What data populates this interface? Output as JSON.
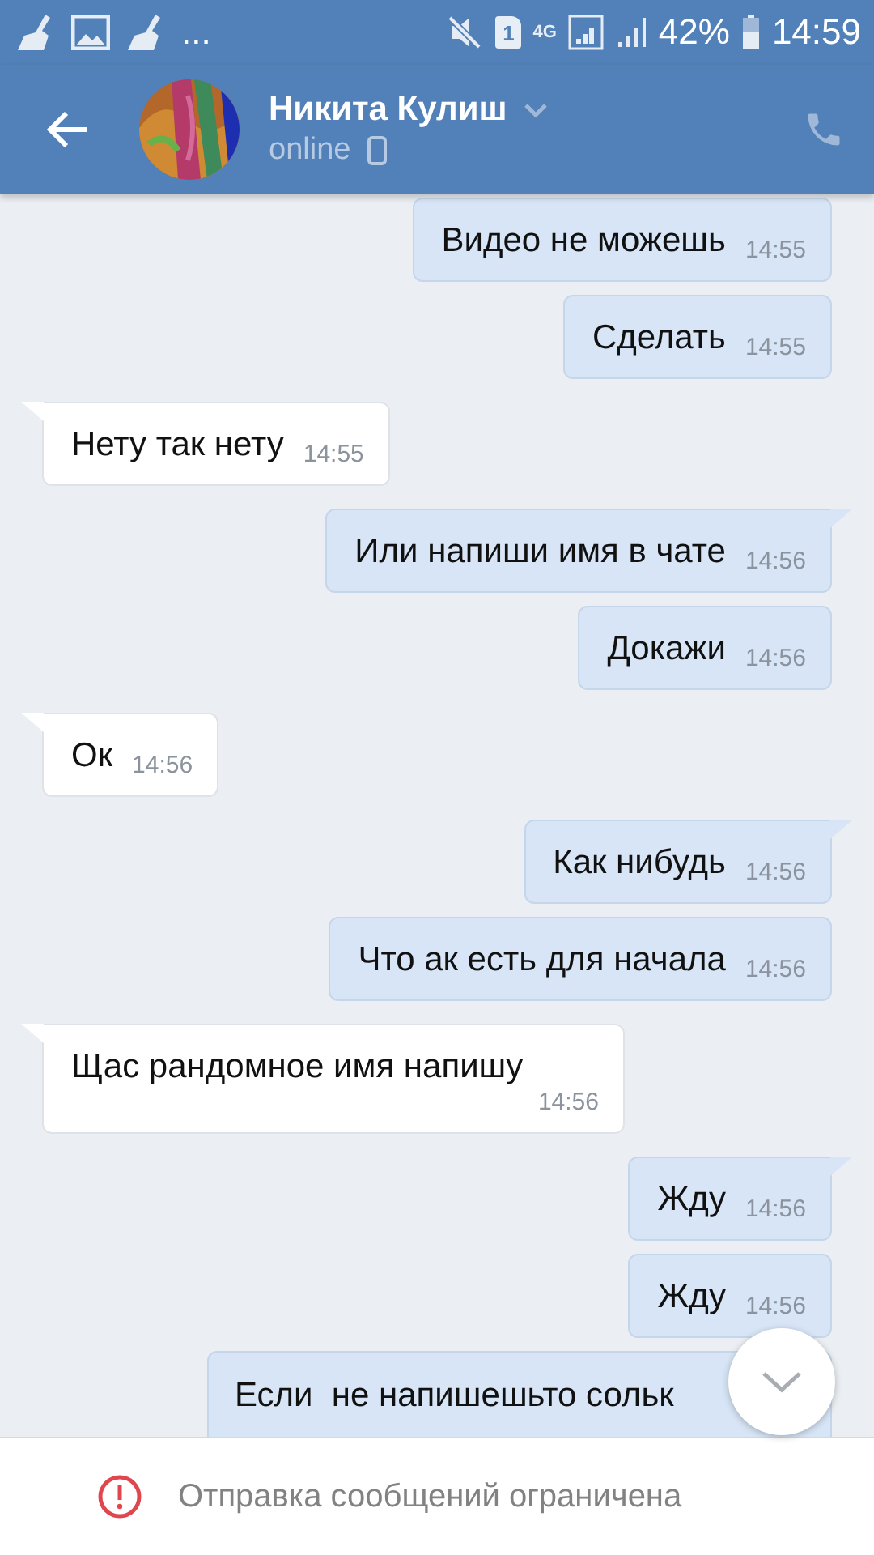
{
  "status_bar": {
    "overflow": "...",
    "sim": "1",
    "network": "4G",
    "battery": "42%",
    "time": "14:59"
  },
  "header": {
    "name": "Никита Кулиш",
    "status": "online"
  },
  "messages": [
    {
      "kind": "out",
      "text": "Видео не можешь",
      "time": "14:55"
    },
    {
      "kind": "out",
      "text": "Сделать",
      "time": "14:55"
    },
    {
      "kind": "in",
      "text": "Нету так нету",
      "time": "14:55"
    },
    {
      "kind": "out",
      "text": "Или напиши имя в чате",
      "time": "14:56"
    },
    {
      "kind": "out",
      "text": "Докажи",
      "time": "14:56"
    },
    {
      "kind": "in",
      "text": "Ок",
      "time": "14:56"
    },
    {
      "kind": "out",
      "text": "Как нибудь",
      "time": "14:56"
    },
    {
      "kind": "out",
      "text": "Что ак есть для начала",
      "time": "14:56"
    },
    {
      "kind": "in",
      "text": "Щас рандомное имя напишу",
      "time": "14:56"
    },
    {
      "kind": "out",
      "text": "Жду",
      "time": "14:56"
    },
    {
      "kind": "out",
      "text": "Жду",
      "time": "14:56"
    },
    {
      "kind": "out",
      "text": "Если  не напишешьто сольк"
    }
  ],
  "footer": {
    "notice": "Отправка сообщений ограничена"
  }
}
